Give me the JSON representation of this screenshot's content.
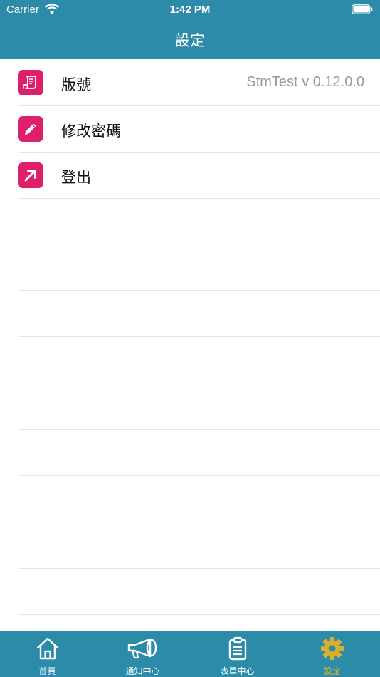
{
  "status_bar": {
    "carrier": "Carrier",
    "time": "1:42 PM"
  },
  "nav": {
    "title": "設定"
  },
  "settings": {
    "items": [
      {
        "label": "版號",
        "value": "StmTest v 0.12.0.0",
        "icon": "document-icon"
      },
      {
        "label": "修改密碼",
        "icon": "pencil-icon"
      },
      {
        "label": "登出",
        "icon": "arrow-up-right-icon"
      }
    ]
  },
  "tabbar": {
    "tabs": [
      {
        "label": "首頁",
        "icon": "home-icon"
      },
      {
        "label": "通知中心",
        "icon": "megaphone-icon"
      },
      {
        "label": "表單中心",
        "icon": "clipboard-icon"
      },
      {
        "label": "設定",
        "icon": "gear-icon",
        "active": true
      }
    ]
  },
  "colors": {
    "header": "#2b8ba9",
    "icon_bg": "#de1f6b",
    "active_tab": "#d9b02e"
  }
}
